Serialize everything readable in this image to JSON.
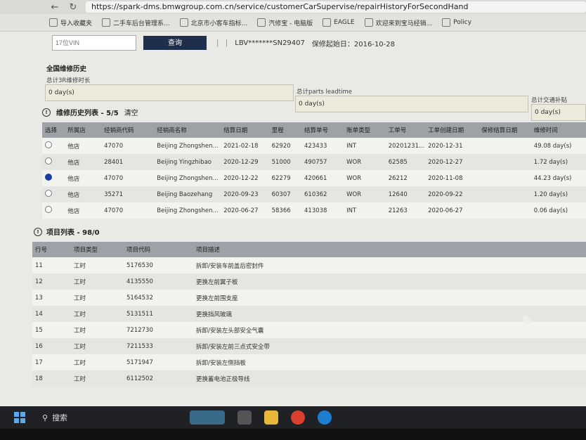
{
  "browser": {
    "url": "https://spark-dms.bmwgroup.com.cn/service/customerCarSupervise/repairHistoryForSecondHand",
    "bookmarks": [
      "导入收藏夹",
      "二手车后台管理系...",
      "北京市小客车指标...",
      "汽修宝 - 电脑版",
      "EAGLE",
      "欢迎来到宝马经销...",
      "Policy"
    ]
  },
  "search": {
    "vin_placeholder": "17位VIN",
    "query_label": "查询",
    "vin_masked": "LBV*******SN29407",
    "warranty_start": "保修起始日：2016-10-28"
  },
  "summary": {
    "title": "全国维修历史",
    "repair_time_label": "总计3R维修时长",
    "repair_time_value": "0 day(s)",
    "parts_label": "总计parts leadtime",
    "parts_value": "0 day(s)",
    "transport_label": "总计交通补贴",
    "transport_value": "0 day(s)"
  },
  "history": {
    "title": "维修历史列表 - 5/5",
    "clear_label": "清空",
    "columns": [
      "选择",
      "所属店",
      "经销商代码",
      "经销商名称",
      "结算日期",
      "里程",
      "结算单号",
      "账单类型",
      "工单号",
      "工单创建日期",
      "保修结算日期",
      "维修时间"
    ],
    "rows": [
      {
        "store": "他店",
        "code": "47070",
        "name": "Beijing Zhongshen...",
        "date": "2021-02-18",
        "mileage": "62920",
        "settle": "423433",
        "type": "INT",
        "wo": "20201231...",
        "created": "2020-12-31",
        "warranty": "",
        "time": "49.08 day(s)",
        "selected": false
      },
      {
        "store": "他店",
        "code": "28401",
        "name": "Beijing Yingzhibao",
        "date": "2020-12-29",
        "mileage": "51000",
        "settle": "490757",
        "type": "WOR",
        "wo": "62585",
        "created": "2020-12-27",
        "warranty": "",
        "time": "1.72 day(s)",
        "selected": false
      },
      {
        "store": "他店",
        "code": "47070",
        "name": "Beijing Zhongshen...",
        "date": "2020-12-22",
        "mileage": "62279",
        "settle": "420661",
        "type": "WOR",
        "wo": "26212",
        "created": "2020-11-08",
        "warranty": "",
        "time": "44.23 day(s)",
        "selected": true
      },
      {
        "store": "他店",
        "code": "35271",
        "name": "Beijing Baozehang",
        "date": "2020-09-23",
        "mileage": "60307",
        "settle": "610362",
        "type": "WOR",
        "wo": "12640",
        "created": "2020-09-22",
        "warranty": "",
        "time": "1.20 day(s)",
        "selected": false
      },
      {
        "store": "他店",
        "code": "47070",
        "name": "Beijing Zhongshen...",
        "date": "2020-06-27",
        "mileage": "58366",
        "settle": "413038",
        "type": "INT",
        "wo": "21263",
        "created": "2020-06-27",
        "warranty": "",
        "time": "0.06 day(s)",
        "selected": false
      }
    ]
  },
  "items": {
    "title": "项目列表 - 98/0",
    "columns": [
      "行号",
      "项目类型",
      "项目代码",
      "项目描述"
    ],
    "rows": [
      {
        "n": "11",
        "type": "工时",
        "code": "5176530",
        "desc": "拆卸/安装车前盖后密封件"
      },
      {
        "n": "12",
        "type": "工时",
        "code": "4135550",
        "desc": "更换左前翼子板"
      },
      {
        "n": "13",
        "type": "工时",
        "code": "5164532",
        "desc": "更换左前围支座"
      },
      {
        "n": "14",
        "type": "工时",
        "code": "5131511",
        "desc": "更换挡风玻璃"
      },
      {
        "n": "15",
        "type": "工时",
        "code": "7212730",
        "desc": "拆卸/安装左头部安全气囊"
      },
      {
        "n": "16",
        "type": "工时",
        "code": "7211533",
        "desc": "拆卸/安装左前三点式安全带"
      },
      {
        "n": "17",
        "type": "工时",
        "code": "5171947",
        "desc": "拆卸/安装左侧挡板"
      },
      {
        "n": "18",
        "type": "工时",
        "code": "6112502",
        "desc": "更换蓄电池正极导线"
      }
    ]
  },
  "taskbar": {
    "search_label": "搜索"
  },
  "colors": {
    "header_bg": "#9ea2a6",
    "query_button": "#1f2e4a",
    "selected_radio": "#1c3ea3"
  }
}
